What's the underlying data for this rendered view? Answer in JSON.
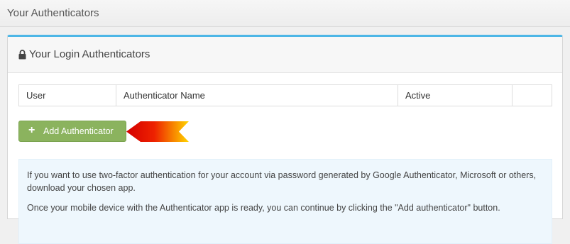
{
  "header": {
    "title": "Your Authenticators"
  },
  "panel": {
    "heading": "Your Login Authenticators",
    "lock_icon": "lock-icon",
    "accent_color": "#4db6e6"
  },
  "table": {
    "columns": [
      "User",
      "Authenticator Name",
      "Active",
      ""
    ]
  },
  "add_button": {
    "label": "Add Authenticator",
    "icon": "plus-icon",
    "color": "#8bb35e"
  },
  "info": {
    "paragraph_1": "If you want to use two-factor authentication for your account via password generated by Google Authenticator, Microsoft or others, download your chosen app.",
    "paragraph_2": "Once your mobile device with the Authenticator app is ready, you can continue by clicking the \"Add authenticator\" button."
  }
}
